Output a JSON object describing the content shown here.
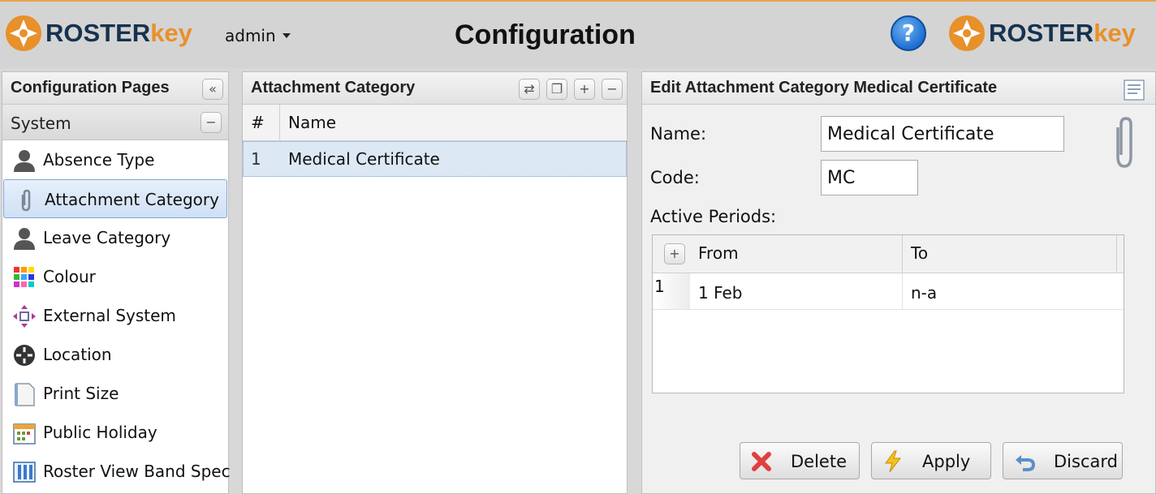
{
  "header": {
    "brand_roster": "ROSTER",
    "brand_key": "key",
    "user": "admin",
    "title": "Configuration",
    "help": "?"
  },
  "left_panel": {
    "title": "Configuration Pages",
    "collapse_icon": "double-chevron-left-icon",
    "group": {
      "label": "System",
      "toggle": "−"
    },
    "items": [
      {
        "label": "Absence Type",
        "icon": "person-icon"
      },
      {
        "label": "Attachment Category",
        "icon": "paperclip-icon",
        "active": true
      },
      {
        "label": "Leave Category",
        "icon": "person-icon"
      },
      {
        "label": "Colour",
        "icon": "color-grid-icon"
      },
      {
        "label": "External System",
        "icon": "arrows-move-icon"
      },
      {
        "label": "Location",
        "icon": "location-target-icon"
      },
      {
        "label": "Print Size",
        "icon": "page-icon"
      },
      {
        "label": "Public Holiday",
        "icon": "calendar-icon"
      },
      {
        "label": "Roster View Band Spec",
        "icon": "band-spec-icon"
      }
    ]
  },
  "middle_panel": {
    "title": "Attachment Category",
    "tools": [
      "refresh-icon",
      "restore-window-icon",
      "add-icon",
      "remove-icon"
    ],
    "columns": [
      "#",
      "Name"
    ],
    "rows": [
      {
        "num": "1",
        "name": "Medical Certificate",
        "selected": true
      }
    ]
  },
  "right_panel": {
    "title": "Edit Attachment Category Medical Certificate",
    "name_label": "Name:",
    "name_value": "Medical Certificate",
    "code_label": "Code:",
    "code_value": "MC",
    "periods_label": "Active Periods:",
    "periods_columns": [
      "From",
      "To"
    ],
    "periods_add": "+",
    "periods": [
      {
        "num": "1",
        "from": "1 Feb",
        "to": "n-a"
      }
    ],
    "buttons": {
      "delete": "Delete",
      "apply": "Apply",
      "discard": "Discard"
    }
  },
  "colors": {
    "brand_orange": "#e8902a",
    "brand_navy": "#16324f",
    "selection": "#dde8f5",
    "help_blue": "#1e6fd0"
  }
}
